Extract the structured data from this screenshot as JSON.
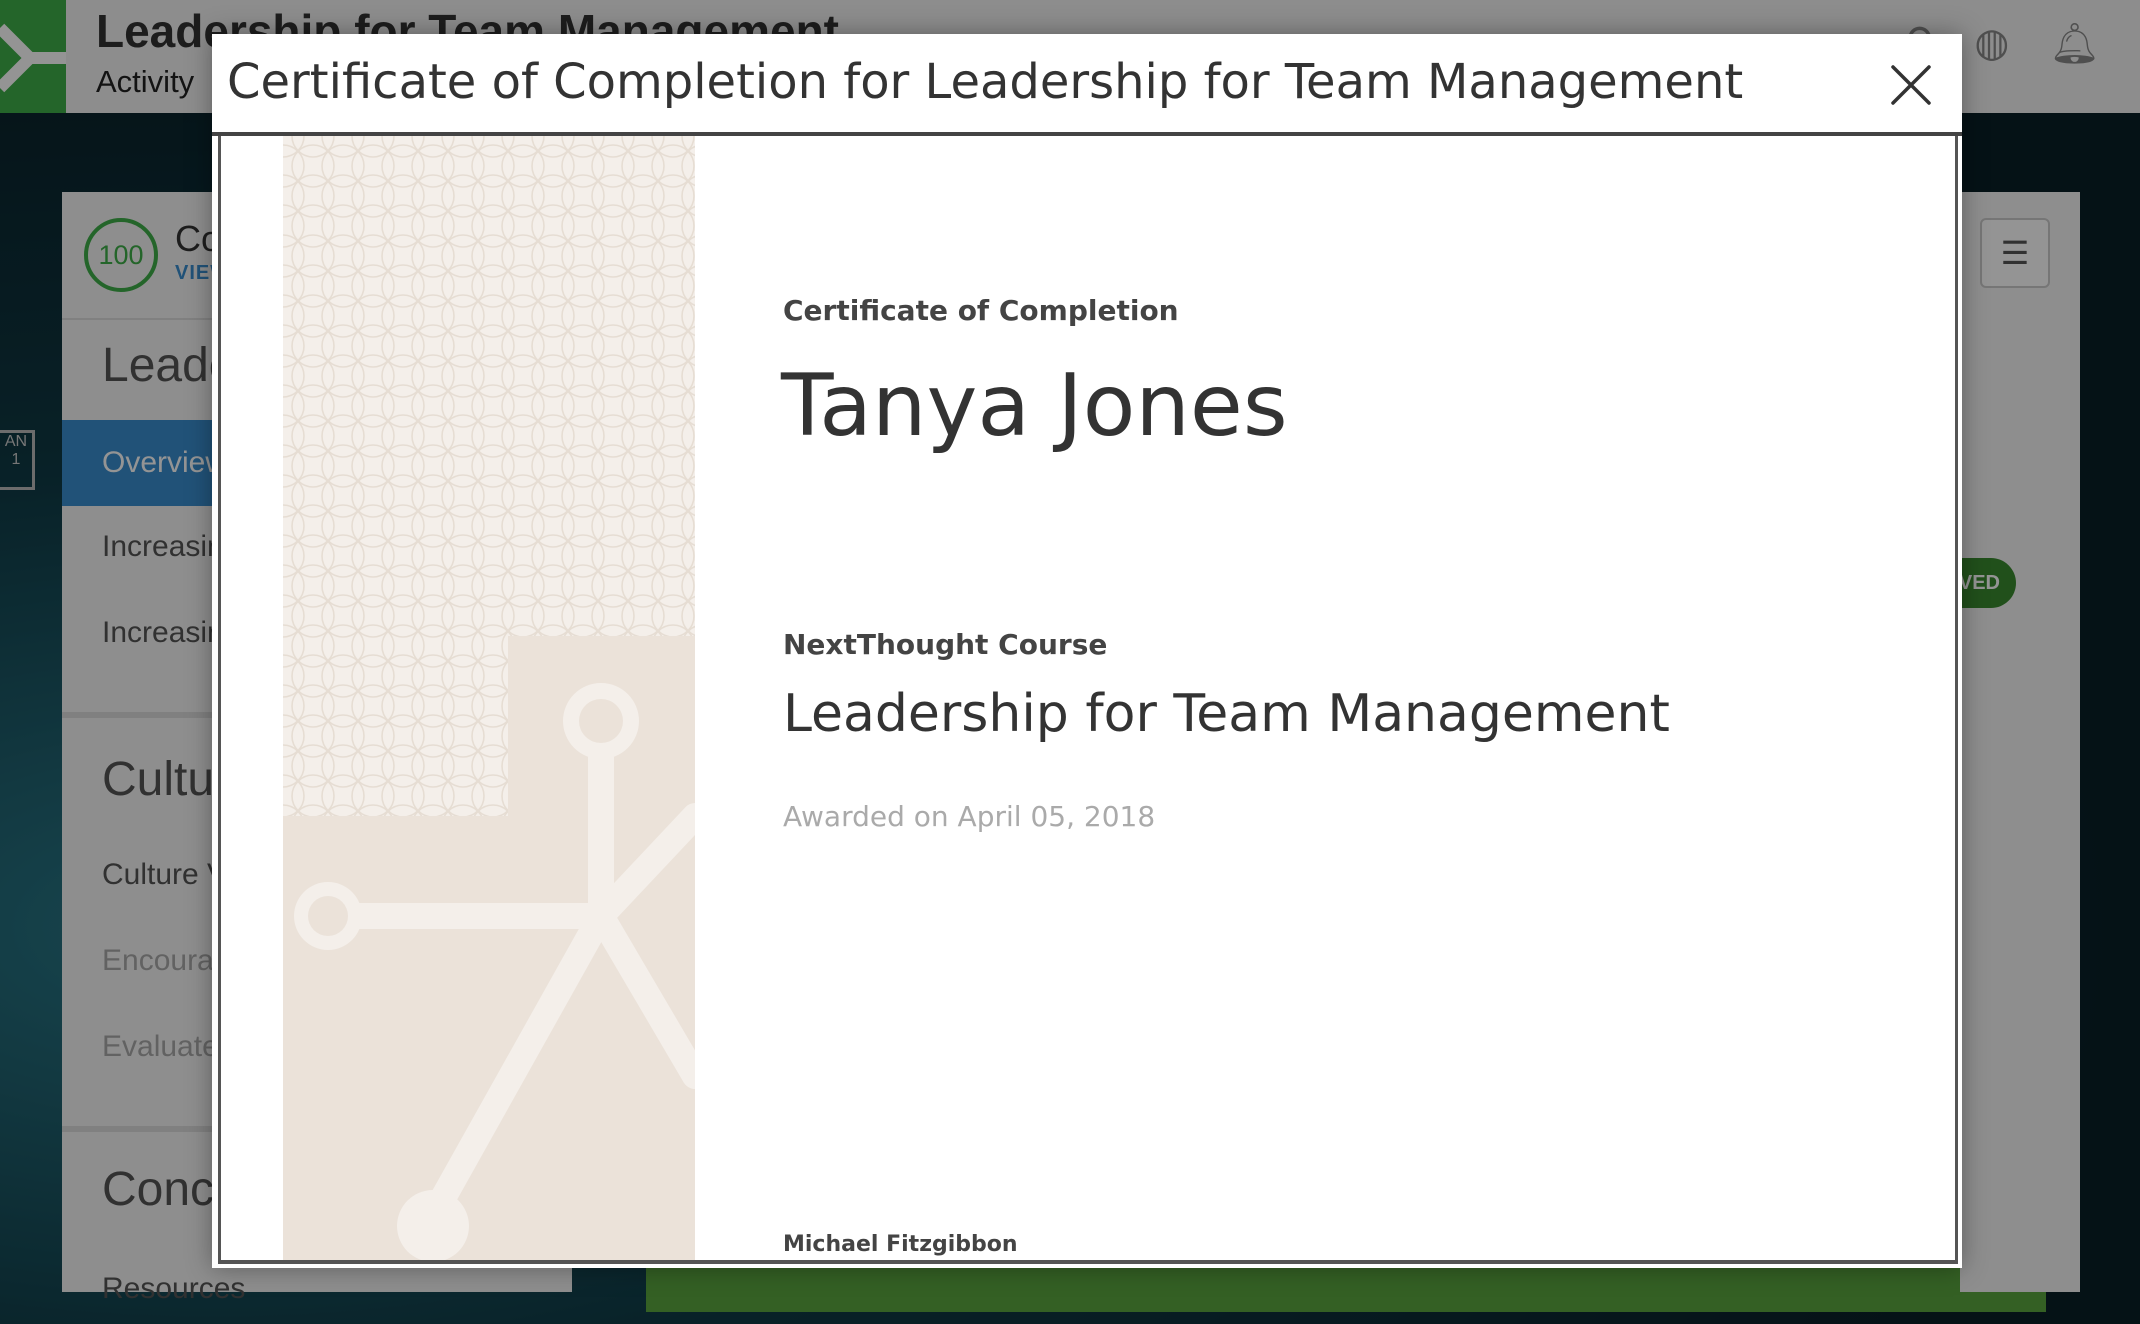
{
  "app": {
    "title": "Leadership for Team Management",
    "title_chevron": "⌄",
    "nav_current": "Activity",
    "progress_score": "100",
    "panel_heading_partial": "Co",
    "panel_link_partial": "VIEW",
    "calendar_month_partial": "AN",
    "calendar_day_partial": "1",
    "menu_glyph": "☰",
    "badge_partial": "VED",
    "sections": [
      {
        "title": "Leaders",
        "items": [
          {
            "label": "Overview",
            "state": "active"
          },
          {
            "label": "Increasin",
            "state": "normal"
          },
          {
            "label": "Increasin",
            "state": "normal"
          }
        ]
      },
      {
        "title": "Culture",
        "items": [
          {
            "label": "Culture V",
            "state": "normal"
          },
          {
            "label": "Encoura",
            "state": "muted"
          },
          {
            "label": "Evaluate",
            "state": "muted"
          }
        ]
      },
      {
        "title": "Conclus",
        "items": [
          {
            "label": "Resources",
            "state": "normal"
          }
        ]
      }
    ]
  },
  "modal": {
    "title": "Certificate of Completion for Leadership for Team Management",
    "close_icon": "close-icon"
  },
  "certificate": {
    "heading": "Certificate of Completion",
    "recipient": "Tanya Jones",
    "provider_label": "NextThought Course",
    "course_title": "Leadership for Team Management",
    "awarded": "Awarded on April 05, 2018",
    "signer": "Michael Fitzgibbon"
  },
  "colors": {
    "brand_green": "#3fae49",
    "link_blue": "#3a8ecf",
    "cert_art": "#ece4dc"
  }
}
